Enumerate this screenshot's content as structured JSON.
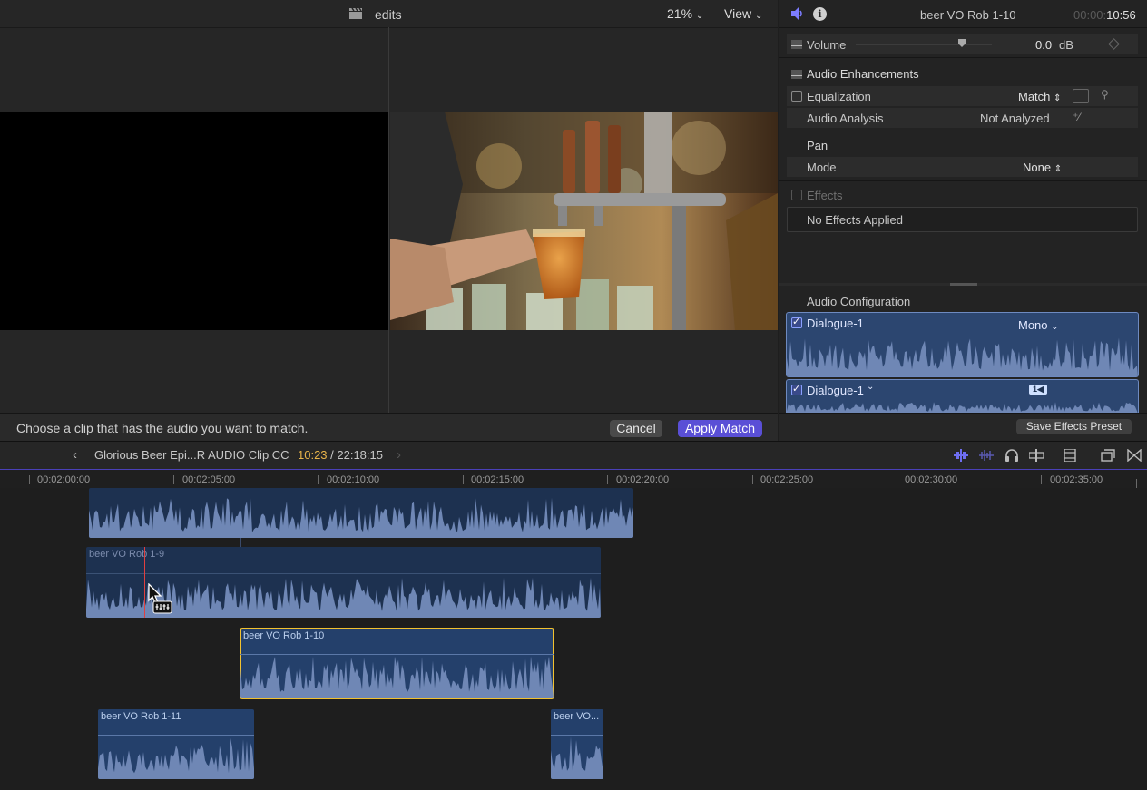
{
  "viewer": {
    "title": "edits",
    "zoom": "21%",
    "view_label": "View",
    "match_prompt": "Choose a clip that has the audio you want to match.",
    "cancel_label": "Cancel",
    "apply_label": "Apply Match"
  },
  "inspector": {
    "clip_name": "beer VO Rob 1-10",
    "timecode_dim": "00:00:",
    "timecode_bright": "10:56",
    "volume_label": "Volume",
    "volume_value": "0.0",
    "volume_unit": "dB",
    "volume_level": 0.78,
    "enhancements_label": "Audio Enhancements",
    "equalization_label": "Equalization",
    "equalization_value": "Match",
    "analysis_label": "Audio Analysis",
    "analysis_value": "Not Analyzed",
    "pan_label": "Pan",
    "mode_label": "Mode",
    "mode_value": "None",
    "effects_label": "Effects",
    "no_effects": "No Effects Applied",
    "config_label": "Audio Configuration",
    "channels": [
      {
        "name": "Dialogue-1",
        "format": "Mono"
      },
      {
        "name": "Dialogue-1",
        "badge": "1"
      }
    ],
    "save_preset_label": "Save Effects Preset"
  },
  "timeline": {
    "project_name": "Glorious Beer Epi...R AUDIO Clip CC",
    "time_current": "10:23",
    "time_total": " / 22:18:15",
    "ruler": [
      "00:02:00:00",
      "00:02:05:00",
      "00:02:10:00",
      "00:02:15:00",
      "00:02:20:00",
      "00:02:25:00",
      "00:02:30:00",
      "00:02:35:00"
    ],
    "clips": {
      "clip_top": "",
      "clip_1_9": "beer VO Rob 1-9",
      "clip_1_10": "beer VO Rob 1-10",
      "clip_1_11": "beer VO Rob 1-11",
      "clip_short": "beer VO..."
    }
  },
  "colors": {
    "accent": "#5a4fd6",
    "selection": "#f2c230",
    "clip_fill": "#1d3150",
    "waveform": "#6f87b5",
    "playhead": "#e04040"
  }
}
